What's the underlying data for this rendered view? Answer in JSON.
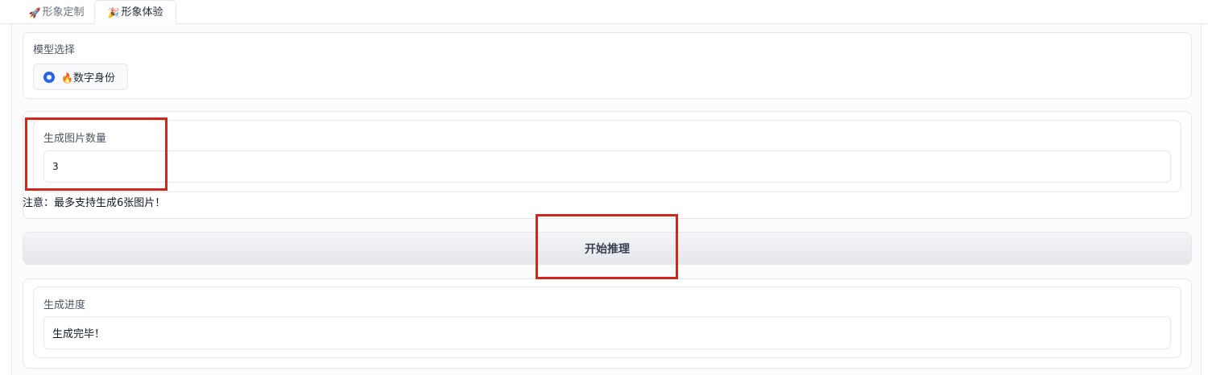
{
  "tabs": [
    {
      "icon": "🚀",
      "label": "形象定制",
      "active": false
    },
    {
      "icon": "🎉",
      "label": "形象体验",
      "active": true
    }
  ],
  "model_select": {
    "label": "模型选择",
    "option": {
      "icon": "🔥",
      "label": "数字身份",
      "selected": true
    }
  },
  "image_count": {
    "label": "生成图片数量",
    "value": "3",
    "note": "注意：最多支持生成6张图片！"
  },
  "run_button": {
    "label": "开始推理"
  },
  "progress": {
    "label": "生成进度",
    "value": "生成完毕！"
  },
  "colors": {
    "accent": "#2563eb",
    "highlight_box": "#d0271d"
  }
}
